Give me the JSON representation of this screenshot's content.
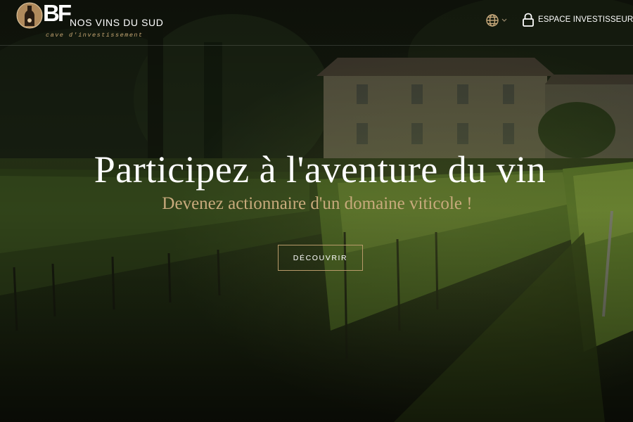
{
  "brand": {
    "initials": "BF",
    "name": "NOS VINS DU SUD",
    "tagline": "cave d'investissement"
  },
  "header": {
    "language_icon": "globe-icon",
    "language_chevron_icon": "chevron-down-icon",
    "investor_icon": "lock-icon",
    "investor_label": "ESPACE INVESTISSEURS"
  },
  "hero": {
    "title": "Participez à l'aventure du vin",
    "subtitle": "Devenez actionnaire d'un domaine viticole !",
    "cta_label": "DÉCOUVRIR"
  },
  "colors": {
    "accent_gold": "#c8aa7c",
    "text_white": "#ffffff",
    "overlay": "#000000"
  }
}
